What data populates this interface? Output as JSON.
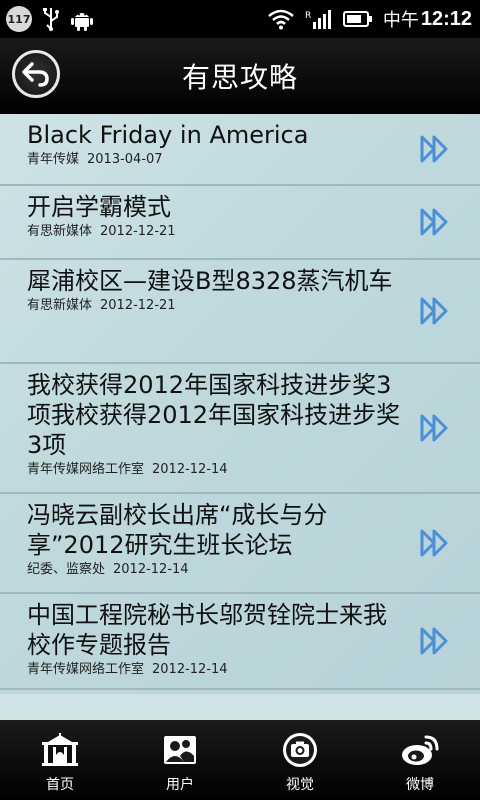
{
  "status_bar": {
    "notification_count": "117",
    "ampm": "中午",
    "time": "12:12",
    "icons": [
      "usb-icon",
      "android-icon",
      "wifi-icon",
      "signal-icon",
      "battery-icon"
    ]
  },
  "header": {
    "title": "有思攻略",
    "back_icon": "back-arrow-icon"
  },
  "articles": [
    {
      "title": "Black Friday in America",
      "source": "青年传媒",
      "date": "2013-04-07"
    },
    {
      "title": "开启学霸模式",
      "source": "有思新媒体",
      "date": "2012-12-21"
    },
    {
      "title": "犀浦校区—建设B型8328蒸汽机车",
      "source": "有思新媒体",
      "date": "2012-12-21"
    },
    {
      "title": "我校获得2012年国家科技进步奖3项我校获得2012年国家科技进步奖3项",
      "source": "青年传媒网络工作室",
      "date": "2012-12-14"
    },
    {
      "title": "冯晓云副校长出席“成长与分享”2012研究生班长论坛",
      "source": "纪委、监察处",
      "date": "2012-12-14"
    },
    {
      "title": "中国工程院秘书长邬贺铨院士来我校作专题报告",
      "source": "青年传媒网络工作室",
      "date": "2012-12-14"
    }
  ],
  "tabs": [
    {
      "label": "首页",
      "icon": "home-gate-icon"
    },
    {
      "label": "用户",
      "icon": "users-icon"
    },
    {
      "label": "视觉",
      "icon": "camera-icon"
    },
    {
      "label": "微博",
      "icon": "weibo-icon"
    }
  ],
  "colors": {
    "content_bg": "#c6dde1",
    "arrow": "#4a8fd8",
    "bar_bg": "#000000"
  }
}
